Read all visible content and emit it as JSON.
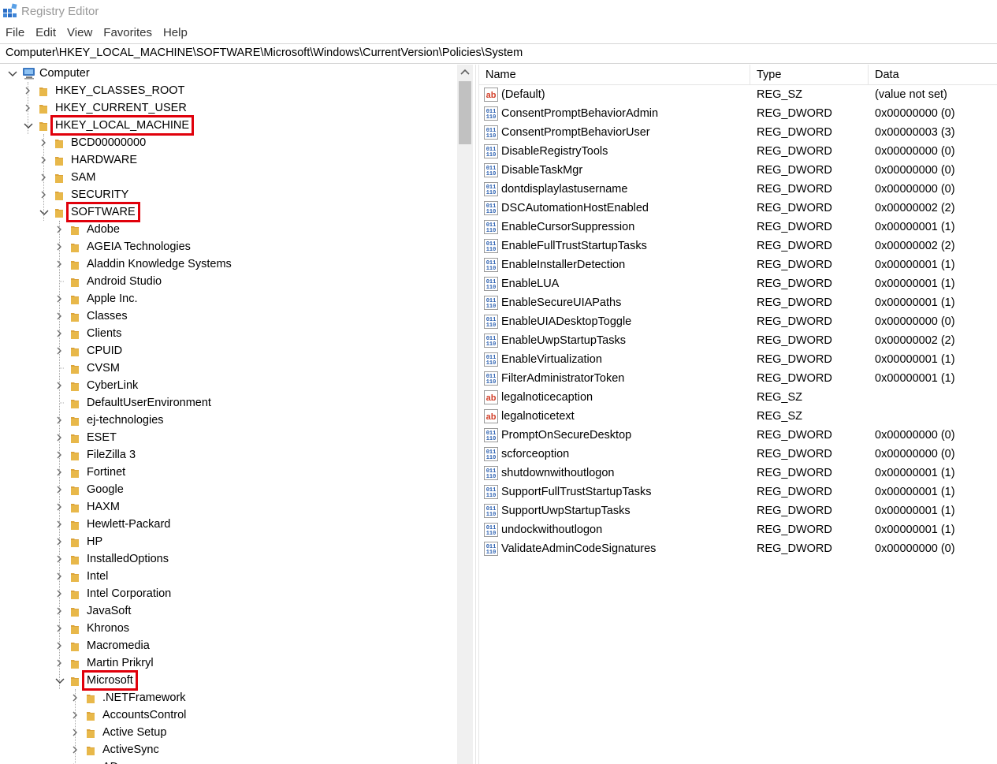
{
  "window": {
    "title": "Registry Editor"
  },
  "menu": [
    "File",
    "Edit",
    "View",
    "Favorites",
    "Help"
  ],
  "address": {
    "path": "Computer\\HKEY_LOCAL_MACHINE\\SOFTWARE\\Microsoft\\Windows\\CurrentVersion\\Policies\\System"
  },
  "colors": {
    "highlight": "#e0000b",
    "folder": "#e8b84a",
    "computer": "#3b78c2"
  },
  "tree": [
    {
      "label": "Computer",
      "level": 0,
      "state": "expanded",
      "icon": "computer-icon"
    },
    {
      "label": "HKEY_CLASSES_ROOT",
      "level": 1,
      "state": "collapsed"
    },
    {
      "label": "HKEY_CURRENT_USER",
      "level": 1,
      "state": "collapsed"
    },
    {
      "label": "HKEY_LOCAL_MACHINE",
      "level": 1,
      "state": "expanded",
      "highlight": true
    },
    {
      "label": "BCD00000000",
      "level": 2,
      "state": "collapsed"
    },
    {
      "label": "HARDWARE",
      "level": 2,
      "state": "collapsed"
    },
    {
      "label": "SAM",
      "level": 2,
      "state": "collapsed"
    },
    {
      "label": "SECURITY",
      "level": 2,
      "state": "collapsed"
    },
    {
      "label": "SOFTWARE",
      "level": 2,
      "state": "expanded",
      "highlight": true
    },
    {
      "label": "Adobe",
      "level": 3,
      "state": "collapsed"
    },
    {
      "label": "AGEIA Technologies",
      "level": 3,
      "state": "collapsed"
    },
    {
      "label": "Aladdin Knowledge Systems",
      "level": 3,
      "state": "collapsed"
    },
    {
      "label": "Android Studio",
      "level": 3,
      "state": "leaf"
    },
    {
      "label": "Apple Inc.",
      "level": 3,
      "state": "collapsed"
    },
    {
      "label": "Classes",
      "level": 3,
      "state": "collapsed"
    },
    {
      "label": "Clients",
      "level": 3,
      "state": "collapsed"
    },
    {
      "label": "CPUID",
      "level": 3,
      "state": "collapsed"
    },
    {
      "label": "CVSM",
      "level": 3,
      "state": "leaf"
    },
    {
      "label": "CyberLink",
      "level": 3,
      "state": "collapsed"
    },
    {
      "label": "DefaultUserEnvironment",
      "level": 3,
      "state": "leaf"
    },
    {
      "label": "ej-technologies",
      "level": 3,
      "state": "collapsed"
    },
    {
      "label": "ESET",
      "level": 3,
      "state": "collapsed"
    },
    {
      "label": "FileZilla 3",
      "level": 3,
      "state": "collapsed"
    },
    {
      "label": "Fortinet",
      "level": 3,
      "state": "collapsed"
    },
    {
      "label": "Google",
      "level": 3,
      "state": "collapsed"
    },
    {
      "label": "HAXM",
      "level": 3,
      "state": "collapsed"
    },
    {
      "label": "Hewlett-Packard",
      "level": 3,
      "state": "collapsed"
    },
    {
      "label": "HP",
      "level": 3,
      "state": "collapsed"
    },
    {
      "label": "InstalledOptions",
      "level": 3,
      "state": "collapsed"
    },
    {
      "label": "Intel",
      "level": 3,
      "state": "collapsed"
    },
    {
      "label": "Intel Corporation",
      "level": 3,
      "state": "collapsed"
    },
    {
      "label": "JavaSoft",
      "level": 3,
      "state": "collapsed"
    },
    {
      "label": "Khronos",
      "level": 3,
      "state": "collapsed"
    },
    {
      "label": "Macromedia",
      "level": 3,
      "state": "collapsed"
    },
    {
      "label": "Martin Prikryl",
      "level": 3,
      "state": "collapsed"
    },
    {
      "label": "Microsoft",
      "level": 3,
      "state": "expanded",
      "highlight": true
    },
    {
      "label": ".NETFramework",
      "level": 4,
      "state": "collapsed"
    },
    {
      "label": "AccountsControl",
      "level": 4,
      "state": "collapsed"
    },
    {
      "label": "Active Setup",
      "level": 4,
      "state": "collapsed"
    },
    {
      "label": "ActiveSync",
      "level": 4,
      "state": "collapsed"
    },
    {
      "label": "ADs",
      "level": 4,
      "state": "collapsed"
    }
  ],
  "columns": {
    "name": "Name",
    "type": "Type",
    "data": "Data"
  },
  "values": [
    {
      "name": "(Default)",
      "type": "REG_SZ",
      "data": "(value not set)",
      "icon": "string-value-icon"
    },
    {
      "name": "ConsentPromptBehaviorAdmin",
      "type": "REG_DWORD",
      "data": "0x00000000 (0)",
      "icon": "dword-value-icon"
    },
    {
      "name": "ConsentPromptBehaviorUser",
      "type": "REG_DWORD",
      "data": "0x00000003 (3)",
      "icon": "dword-value-icon"
    },
    {
      "name": "DisableRegistryTools",
      "type": "REG_DWORD",
      "data": "0x00000000 (0)",
      "icon": "dword-value-icon"
    },
    {
      "name": "DisableTaskMgr",
      "type": "REG_DWORD",
      "data": "0x00000000 (0)",
      "icon": "dword-value-icon"
    },
    {
      "name": "dontdisplaylastusername",
      "type": "REG_DWORD",
      "data": "0x00000000 (0)",
      "icon": "dword-value-icon"
    },
    {
      "name": "DSCAutomationHostEnabled",
      "type": "REG_DWORD",
      "data": "0x00000002 (2)",
      "icon": "dword-value-icon"
    },
    {
      "name": "EnableCursorSuppression",
      "type": "REG_DWORD",
      "data": "0x00000001 (1)",
      "icon": "dword-value-icon"
    },
    {
      "name": "EnableFullTrustStartupTasks",
      "type": "REG_DWORD",
      "data": "0x00000002 (2)",
      "icon": "dword-value-icon"
    },
    {
      "name": "EnableInstallerDetection",
      "type": "REG_DWORD",
      "data": "0x00000001 (1)",
      "icon": "dword-value-icon"
    },
    {
      "name": "EnableLUA",
      "type": "REG_DWORD",
      "data": "0x00000001 (1)",
      "icon": "dword-value-icon"
    },
    {
      "name": "EnableSecureUIAPaths",
      "type": "REG_DWORD",
      "data": "0x00000001 (1)",
      "icon": "dword-value-icon"
    },
    {
      "name": "EnableUIADesktopToggle",
      "type": "REG_DWORD",
      "data": "0x00000000 (0)",
      "icon": "dword-value-icon"
    },
    {
      "name": "EnableUwpStartupTasks",
      "type": "REG_DWORD",
      "data": "0x00000002 (2)",
      "icon": "dword-value-icon"
    },
    {
      "name": "EnableVirtualization",
      "type": "REG_DWORD",
      "data": "0x00000001 (1)",
      "icon": "dword-value-icon"
    },
    {
      "name": "FilterAdministratorToken",
      "type": "REG_DWORD",
      "data": "0x00000001 (1)",
      "icon": "dword-value-icon"
    },
    {
      "name": "legalnoticecaption",
      "type": "REG_SZ",
      "data": "",
      "icon": "string-value-icon"
    },
    {
      "name": "legalnoticetext",
      "type": "REG_SZ",
      "data": "",
      "icon": "string-value-icon"
    },
    {
      "name": "PromptOnSecureDesktop",
      "type": "REG_DWORD",
      "data": "0x00000000 (0)",
      "icon": "dword-value-icon"
    },
    {
      "name": "scforceoption",
      "type": "REG_DWORD",
      "data": "0x00000000 (0)",
      "icon": "dword-value-icon"
    },
    {
      "name": "shutdownwithoutlogon",
      "type": "REG_DWORD",
      "data": "0x00000001 (1)",
      "icon": "dword-value-icon"
    },
    {
      "name": "SupportFullTrustStartupTasks",
      "type": "REG_DWORD",
      "data": "0x00000001 (1)",
      "icon": "dword-value-icon"
    },
    {
      "name": "SupportUwpStartupTasks",
      "type": "REG_DWORD",
      "data": "0x00000001 (1)",
      "icon": "dword-value-icon"
    },
    {
      "name": "undockwithoutlogon",
      "type": "REG_DWORD",
      "data": "0x00000001 (1)",
      "icon": "dword-value-icon"
    },
    {
      "name": "ValidateAdminCodeSignatures",
      "type": "REG_DWORD",
      "data": "0x00000000 (0)",
      "icon": "dword-value-icon"
    }
  ]
}
